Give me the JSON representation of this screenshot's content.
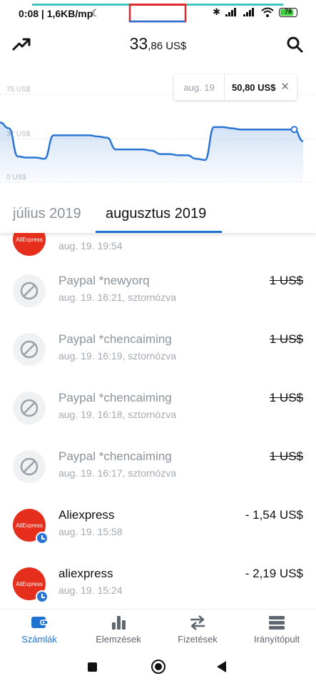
{
  "status": {
    "time_speed": "0:08 | 1,6KB/mp",
    "battery": "78"
  },
  "header": {
    "balance_main": "33",
    "balance_sub": ",86 US$"
  },
  "chart_data": {
    "type": "area",
    "ytick_labels": [
      "75 US$",
      "37 US$",
      "0 US$"
    ],
    "yticks": [
      75,
      37,
      0
    ],
    "ylim": [
      0,
      75
    ],
    "x": [
      0,
      1,
      2,
      3,
      4,
      5,
      6,
      7,
      8,
      9,
      10,
      11,
      12,
      13,
      14,
      15,
      16,
      17,
      18,
      19,
      20,
      21,
      22,
      23,
      24,
      25,
      26,
      27,
      28,
      29,
      30,
      31,
      32,
      33,
      34
    ],
    "values": [
      51,
      46,
      22,
      21,
      21,
      20,
      40,
      40,
      40,
      40,
      40,
      39,
      38,
      28,
      28,
      28,
      28,
      27,
      24,
      24,
      23,
      23,
      20,
      19,
      47,
      47,
      46,
      45,
      45,
      45,
      45,
      45,
      45,
      45,
      35
    ],
    "series_color": "#2a74d4",
    "tooltip_date": "aug. 19",
    "tooltip_value": "50,80 US$"
  },
  "tabs": {
    "items": [
      "július 2019",
      "augusztus 2019"
    ],
    "active": "augusztus 2019"
  },
  "transactions": [
    {
      "name": "",
      "meta": "aug. 19. 19:54",
      "amount": "",
      "kind": "ali"
    },
    {
      "name": "Paypal *newyorq",
      "meta": "aug. 19. 16:21, sztornózva",
      "amount": "1 US$",
      "kind": "cancel"
    },
    {
      "name": "Paypal *chencaiming",
      "meta": "aug. 19. 16:19, sztornózva",
      "amount": "1 US$",
      "kind": "cancel"
    },
    {
      "name": "Paypal *chencaiming",
      "meta": "aug. 19. 16:18, sztornózva",
      "amount": "1 US$",
      "kind": "cancel"
    },
    {
      "name": "Paypal *chencaiming",
      "meta": "aug. 19. 16:17, sztornózva",
      "amount": "1 US$",
      "kind": "cancel"
    },
    {
      "name": "Aliexpress",
      "meta": "aug. 19. 15:58",
      "amount": "- 1,54 US$",
      "kind": "ali"
    },
    {
      "name": "aliexpress",
      "meta": "aug. 19. 15:24",
      "amount": "- 2,19 US$",
      "kind": "ali"
    }
  ],
  "ali_logo_text": "AliExpress",
  "bottom_nav": [
    {
      "label": "Számlák",
      "icon": "wallet-icon",
      "active": true
    },
    {
      "label": "Elemzések",
      "icon": "bar-chart-icon",
      "active": false
    },
    {
      "label": "Fizetések",
      "icon": "transfer-arrows-icon",
      "active": false
    },
    {
      "label": "Irányítópult",
      "icon": "dashboard-icon",
      "active": false
    }
  ],
  "colors": {
    "accent": "#1f73d0",
    "ali_red": "#e52e1c",
    "muted_text": "#a3aab2"
  }
}
